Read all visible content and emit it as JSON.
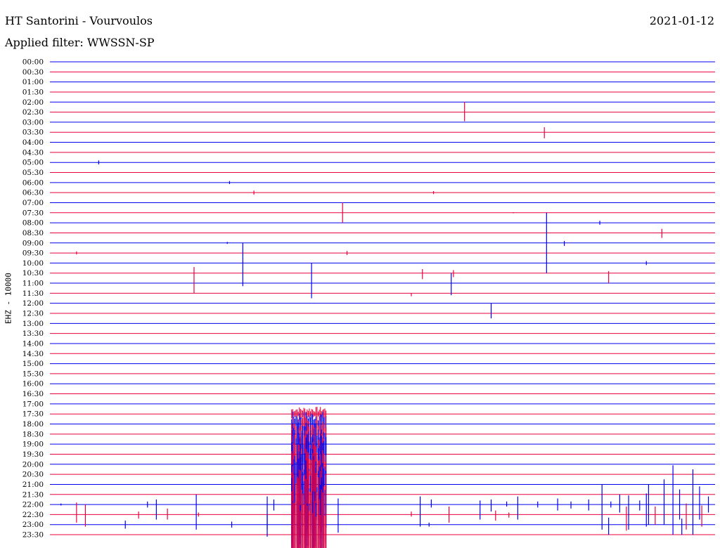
{
  "header": {
    "title": "HT Santorini - Vourvoulos",
    "date": "2021-01-12",
    "filter": "Applied filter: WWSSN-SP"
  },
  "chart_data": {
    "type": "line",
    "ylabel": "EHZ - 10000",
    "row_colors": [
      "#0000ee",
      "#e8003c"
    ],
    "rows": [
      "00:00",
      "00:30",
      "01:00",
      "01:30",
      "02:00",
      "02:30",
      "03:00",
      "03:30",
      "04:00",
      "04:30",
      "05:00",
      "05:30",
      "06:00",
      "06:30",
      "07:00",
      "07:30",
      "08:00",
      "08:30",
      "09:00",
      "09:30",
      "10:00",
      "10:30",
      "11:00",
      "11:30",
      "12:00",
      "12:30",
      "13:00",
      "13:30",
      "14:00",
      "14:30",
      "15:00",
      "15:30",
      "16:00",
      "16:30",
      "17:00",
      "17:30",
      "18:00",
      "18:30",
      "19:00",
      "19:30",
      "20:00",
      "20:30",
      "21:00",
      "21:30",
      "22:00",
      "22:30",
      "23:00",
      "23:30"
    ],
    "events": [
      {
        "row": 5,
        "minute": 18.7,
        "up": 1.0,
        "down": 0.9
      },
      {
        "row": 7,
        "minute": 22.3,
        "up": 0.5,
        "down": 0.6
      },
      {
        "row": 10,
        "minute": 2.2,
        "up": 0.2,
        "down": 0.2
      },
      {
        "row": 12,
        "minute": 8.1,
        "up": 0.15,
        "down": 0.15
      },
      {
        "row": 13,
        "minute": 9.2,
        "up": 0.2,
        "down": 0.2
      },
      {
        "row": 13,
        "minute": 17.3,
        "up": 0.15,
        "down": 0.15
      },
      {
        "row": 15,
        "minute": 13.2,
        "up": 1.0,
        "down": 1.0
      },
      {
        "row": 15,
        "minute": 20.9,
        "up": 0.05,
        "down": 0.05
      },
      {
        "row": 16,
        "minute": 24.8,
        "up": 0.2,
        "down": 0.2
      },
      {
        "row": 17,
        "minute": 27.6,
        "up": 0.4,
        "down": 0.5
      },
      {
        "row": 18,
        "minute": 8.0,
        "up": 0.1,
        "down": 0.1
      },
      {
        "row": 18,
        "minute": 22.4,
        "up": 3.0,
        "down": 3.0
      },
      {
        "row": 18,
        "minute": 23.2,
        "up": 0.2,
        "down": 0.3
      },
      {
        "row": 19,
        "minute": 1.2,
        "up": 0.15,
        "down": 0.15
      },
      {
        "row": 19,
        "minute": 13.4,
        "up": 0.2,
        "down": 0.2
      },
      {
        "row": 20,
        "minute": 26.9,
        "up": 0.2,
        "down": 0.2
      },
      {
        "row": 21,
        "minute": 6.5,
        "up": 0.6,
        "down": 2.0
      },
      {
        "row": 21,
        "minute": 16.8,
        "up": 0.4,
        "down": 0.6
      },
      {
        "row": 21,
        "minute": 18.2,
        "up": 0.3,
        "down": 0.4
      },
      {
        "row": 20,
        "minute": 8.7,
        "up": 2.0,
        "down": 2.3
      },
      {
        "row": 21,
        "minute": 25.2,
        "up": 0.2,
        "down": 1.0
      },
      {
        "row": 22,
        "minute": 18.1,
        "up": 1.0,
        "down": 1.2
      },
      {
        "row": 23,
        "minute": 16.3,
        "up": 0.0,
        "down": 0.3
      },
      {
        "row": 24,
        "minute": 19.9,
        "up": 0.0,
        "down": 1.5
      },
      {
        "row": 20,
        "minute": 11.8,
        "up": 0.0,
        "down": 3.5
      },
      {
        "row": 44,
        "minute": 0.5,
        "up": 0.1,
        "down": 0.1
      },
      {
        "row": 44,
        "minute": 4.4,
        "up": 0.3,
        "down": 0.3
      },
      {
        "row": 44,
        "minute": 4.8,
        "up": 0.5,
        "down": 1.5
      },
      {
        "row": 44,
        "minute": 6.6,
        "up": 1.0,
        "down": 2.5
      },
      {
        "row": 44,
        "minute": 9.8,
        "up": 0.8,
        "down": 2.5
      },
      {
        "row": 44,
        "minute": 10.1,
        "up": 0.5,
        "down": 0.6
      },
      {
        "row": 44,
        "minute": 13.0,
        "up": 0.6,
        "down": 2.8
      },
      {
        "row": 44,
        "minute": 16.7,
        "up": 0.8,
        "down": 2.2
      },
      {
        "row": 44,
        "minute": 19.4,
        "up": 0.4,
        "down": 1.5
      },
      {
        "row": 44,
        "minute": 19.9,
        "up": 0.5,
        "down": 0.7
      },
      {
        "row": 44,
        "minute": 20.6,
        "up": 0.3,
        "down": 0.2
      },
      {
        "row": 44,
        "minute": 24.9,
        "up": 2.0,
        "down": 2.5
      },
      {
        "row": 44,
        "minute": 26.1,
        "up": 0.9,
        "down": 2.5
      },
      {
        "row": 44,
        "minute": 26.9,
        "up": 1.1,
        "down": 2.2
      },
      {
        "row": 44,
        "minute": 28.1,
        "up": 3.9,
        "down": 3.0
      },
      {
        "row": 44,
        "minute": 29.0,
        "up": 3.5,
        "down": 3.0
      },
      {
        "row": 44,
        "minute": 29.3,
        "up": 1.8,
        "down": 1.5
      },
      {
        "row": 45,
        "minute": 1.2,
        "up": 1.2,
        "down": 0.8
      },
      {
        "row": 45,
        "minute": 1.6,
        "up": 1.0,
        "down": 1.2
      },
      {
        "row": 45,
        "minute": 4.0,
        "up": 0.3,
        "down": 0.4
      },
      {
        "row": 45,
        "minute": 5.3,
        "up": 0.6,
        "down": 0.5
      },
      {
        "row": 45,
        "minute": 6.7,
        "up": 0.2,
        "down": 0.2
      },
      {
        "row": 46,
        "minute": 3.4,
        "up": 0.4,
        "down": 0.4
      },
      {
        "row": 46,
        "minute": 8.2,
        "up": 0.3,
        "down": 0.3
      },
      {
        "row": 46,
        "minute": 9.8,
        "up": 1.0,
        "down": 1.2
      },
      {
        "row": 46,
        "minute": 11.4,
        "up": 0.2,
        "down": 0.1
      },
      {
        "row": 45,
        "minute": 11.9,
        "up": 0.5,
        "down": 1.0
      },
      {
        "row": 45,
        "minute": 18.0,
        "up": 0.8,
        "down": 0.8
      },
      {
        "row": 45,
        "minute": 16.3,
        "up": 0.3,
        "down": 0.2
      },
      {
        "row": 45,
        "minute": 20.1,
        "up": 0.4,
        "down": 0.6
      },
      {
        "row": 45,
        "minute": 20.7,
        "up": 0.2,
        "down": 0.3
      },
      {
        "row": 46,
        "minute": 17.1,
        "up": 0.2,
        "down": 0.2
      },
      {
        "row": 44,
        "minute": 17.2,
        "up": 0.5,
        "down": 0.3
      },
      {
        "row": 44,
        "minute": 21.1,
        "up": 0.8,
        "down": 1.5
      },
      {
        "row": 44,
        "minute": 22.0,
        "up": 0.3,
        "down": 0.3
      },
      {
        "row": 44,
        "minute": 22.9,
        "up": 0.6,
        "down": 0.6
      },
      {
        "row": 44,
        "minute": 23.5,
        "up": 0.3,
        "down": 0.4
      },
      {
        "row": 44,
        "minute": 24.3,
        "up": 0.5,
        "down": 0.6
      },
      {
        "row": 44,
        "minute": 25.3,
        "up": 0.3,
        "down": 0.3
      },
      {
        "row": 44,
        "minute": 25.7,
        "up": 1.0,
        "down": 0.8
      },
      {
        "row": 44,
        "minute": 26.6,
        "up": 0.4,
        "down": 0.6
      },
      {
        "row": 44,
        "minute": 27.0,
        "up": 2.0,
        "down": 2.0
      },
      {
        "row": 44,
        "minute": 27.7,
        "up": 2.5,
        "down": 2.0
      },
      {
        "row": 44,
        "minute": 28.4,
        "up": 1.5,
        "down": 1.5
      },
      {
        "row": 44,
        "minute": 29.7,
        "up": 0.8,
        "down": 0.8
      },
      {
        "row": 45,
        "minute": 26.0,
        "up": 0.8,
        "down": 1.6
      },
      {
        "row": 45,
        "minute": 27.3,
        "up": 0.8,
        "down": 1.0
      },
      {
        "row": 45,
        "minute": 28.7,
        "up": 1.1,
        "down": 1.5
      },
      {
        "row": 45,
        "minute": 29.4,
        "up": 0.9,
        "down": 1.2
      },
      {
        "row": 46,
        "minute": 25.2,
        "up": 0.7,
        "down": 1.0
      },
      {
        "row": 46,
        "minute": 28.5,
        "up": 0.6,
        "down": 1.0
      }
    ],
    "burst": {
      "row_start": 35,
      "row_end": 47,
      "minute_start": 10.9,
      "minute_end": 12.5
    }
  }
}
